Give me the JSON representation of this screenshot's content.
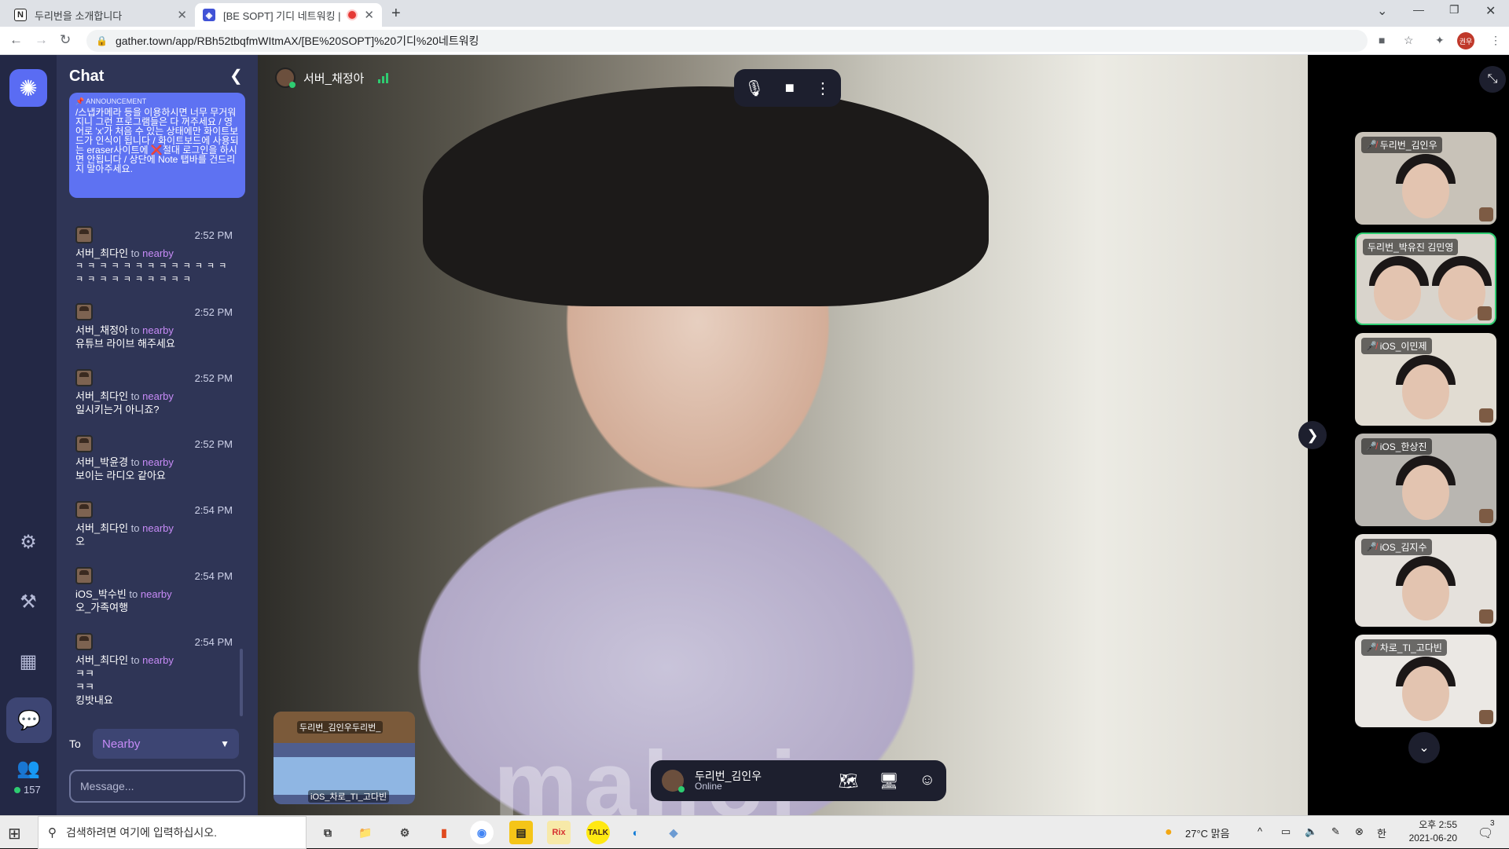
{
  "browser": {
    "tabs": [
      {
        "title": "두리번을 소개합니다",
        "active": false
      },
      {
        "title": "[BE SOPT] 기디 네트워킹 | G",
        "active": true
      }
    ],
    "url": "gather.town/app/RBh52tbqfmWItmAX/[BE%20SOPT]%20기디%20네트워킹",
    "profile_initials": "권우"
  },
  "sidebar": {
    "online_count": "157"
  },
  "chat": {
    "title": "Chat",
    "announcement_label": "ANNOUNCEMENT",
    "announcement": "/스냅카메라 등을 이용하시면 너무 무거워지니 그런 프로그램들은 다 꺼주세요 / 영어로 'x'가 처음 수 있는 상태에만 화이트보드가 인식이 됩니다 / 화이트보드에 사용되는 eraser사이트에 ❌절대 로그인을 하시면 안됩니다 / 상단에 Note 탭바를 건드리지 말아주세요.",
    "to_word": "to",
    "messages": [
      {
        "sender": "서버_최다인",
        "target": "nearby",
        "time": "2:52 PM",
        "body": "ㅋ ㅋ ㅋ ㅋ ㅋ ㅋ ㅋ ㅋ ㅋ ㅋ ㅋ ㅋ ㅋ ㅋ ㅋ ㅋ ㅋ ㅋ ㅋ ㅋ ㅋ ㅋ ㅋ"
      },
      {
        "sender": "서버_채정아",
        "target": "nearby",
        "time": "2:52 PM",
        "body": "유튜브 라이브 해주세요"
      },
      {
        "sender": "서버_최다인",
        "target": "nearby",
        "time": "2:52 PM",
        "body": "일시키는거 아니죠?"
      },
      {
        "sender": "서버_박윤경",
        "target": "nearby",
        "time": "2:52 PM",
        "body": "보이는 라디오 같아요"
      },
      {
        "sender": "서버_최다인",
        "target": "nearby",
        "time": "2:54 PM",
        "body": "오"
      },
      {
        "sender": "iOS_박수빈",
        "target": "nearby",
        "time": "2:54 PM",
        "body": "오_가족여행"
      },
      {
        "sender": "서버_최다인",
        "target": "nearby",
        "time": "2:54 PM",
        "body": "ㅋㅋ\nㅋㅋ\n킹밧내요"
      }
    ],
    "to_label": "To",
    "to_value": "Nearby",
    "message_placeholder": "Message..."
  },
  "main_video": {
    "speaker_name": "서버_채정아",
    "shirt_text": "mahoi"
  },
  "minimap": {
    "label_top": "두리번_김인우두리번_",
    "label_bottom": "iOS_차로_TI_고다빈"
  },
  "status": {
    "name": "두리번_김인우",
    "state": "Online"
  },
  "participants": [
    {
      "name": "두리번_김인우",
      "muted": true,
      "active": false
    },
    {
      "name": "두리번_박유진 김민영",
      "muted": false,
      "active": true
    },
    {
      "name": "iOS_이민제",
      "muted": true,
      "active": false
    },
    {
      "name": "iOS_한상진",
      "muted": true,
      "active": false
    },
    {
      "name": "iOS_김지수",
      "muted": true,
      "active": false
    },
    {
      "name": "차로_TI_고다빈",
      "muted": true,
      "active": false
    }
  ],
  "taskbar": {
    "search_placeholder": "검색하려면 여기에 입력하십시오.",
    "weather": "27°C 맑음",
    "ampm_time": "오후 2:55",
    "date": "2021-06-20",
    "ime": "한",
    "notifications": "3"
  }
}
